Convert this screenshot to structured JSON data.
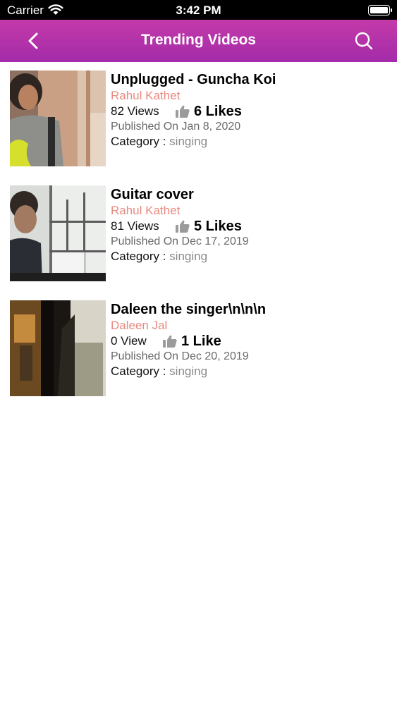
{
  "status_bar": {
    "carrier": "Carrier",
    "time": "3:42 PM"
  },
  "nav": {
    "title": "Trending Videos",
    "back_icon": "chevron-left-icon",
    "search_icon": "search-icon"
  },
  "colors": {
    "nav_bg": "#b733a9",
    "author": "#e88a80",
    "category_value": "#8a8a8a"
  },
  "videos": [
    {
      "title": "Unplugged - Guncha Koi",
      "author": "Rahul Kathet",
      "views": "82 Views",
      "likes": "6 Likes",
      "published": "Published On Jan 8, 2020",
      "category_label": "Category :",
      "category": "singing"
    },
    {
      "title": "Guitar cover",
      "author": "Rahul Kathet",
      "views": "81 Views",
      "likes": "5 Likes",
      "published": "Published On Dec 17, 2019",
      "category_label": "Category :",
      "category": "singing"
    },
    {
      "title": "Daleen the singer\\n\\n\\n",
      "author": "Daleen Jal",
      "views": "0 View",
      "likes": "1 Like",
      "published": "Published On Dec 20, 2019",
      "category_label": "Category :",
      "category": "singing"
    }
  ]
}
